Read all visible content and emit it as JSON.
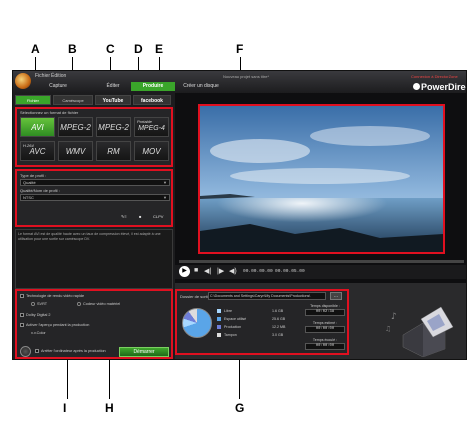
{
  "callouts": {
    "top": [
      "A",
      "B",
      "C",
      "D",
      "E",
      "F"
    ],
    "bottom": [
      "I",
      "H",
      "G"
    ]
  },
  "app": {
    "title": "Nouveau projet sans titre*",
    "link": "Connexion à DirectorZone",
    "brand": "PowerDirector",
    "menus": [
      "Fichier",
      "Édition"
    ],
    "steps": [
      "Capture",
      "Éditer",
      "Produire",
      "Créer un disque"
    ],
    "active_step": "Produire"
  },
  "tabs": [
    "Fichier",
    "Caméscope",
    "YouTube",
    "facebook"
  ],
  "formats": {
    "label": "Sélectionnez un format de fichier",
    "items": [
      {
        "name": "AVI",
        "active": true
      },
      {
        "name": "MPEG-2"
      },
      {
        "name": "MPEG-2"
      },
      {
        "name": "MPEG-4",
        "prefix": "Portable"
      },
      {
        "name": "AVC",
        "prefix": "H.264"
      },
      {
        "name": "WMV"
      },
      {
        "name": "RM"
      },
      {
        "name": "MOV"
      }
    ]
  },
  "profile": {
    "type_label": "Type de profil :",
    "type_value": "Qualité",
    "name_label": "Qualité/Nom de profil :",
    "name_value": "NTSC",
    "tools": [
      "CLPV"
    ]
  },
  "description": "Le format AVI est de qualité haute avec un taux de compression élevé, il est adapté à une utilisation pour une sortie sur caméscope DV.",
  "options": {
    "smart_render": "Technologie de rendu vidéo rapide",
    "sv_rt": "SVRT",
    "hw_encoder": "Codeur vidéo matériel",
    "dolby": "Dolby Digital 2",
    "preview_label": "Activer l'aperçu pendant la production",
    "preview_sub": "x.v.Color",
    "shutdown": "Arrêter l'ordinateur après la production",
    "start_button": "Démarrer"
  },
  "player": {
    "timecode_current": "00.00.00.00",
    "timecode_total": "00.00.05.00"
  },
  "output": {
    "label": "Dossier de sortie :",
    "path": "C:\\Documents and Settings\\Caryn\\My Documents\\Productions\\",
    "browse": "...",
    "legend": [
      {
        "name": "Libre",
        "value": "1.6 GB",
        "color": "#a8d8ff"
      },
      {
        "name": "Espace utilisé",
        "value": "25.6 GB",
        "color": "#5aa5e8"
      },
      {
        "name": "Production",
        "value": "12.2 MB",
        "color": "#6e7ed8"
      },
      {
        "name": "Tampon",
        "value": "3.0 GB",
        "color": "#dddddd"
      }
    ],
    "times": [
      {
        "label": "Temps disponible :",
        "value": "00:02:38"
      },
      {
        "label": "Temps estimé :",
        "value": "00:00:00"
      },
      {
        "label": "Temps écoulé :",
        "value": "00:00:00"
      }
    ]
  }
}
